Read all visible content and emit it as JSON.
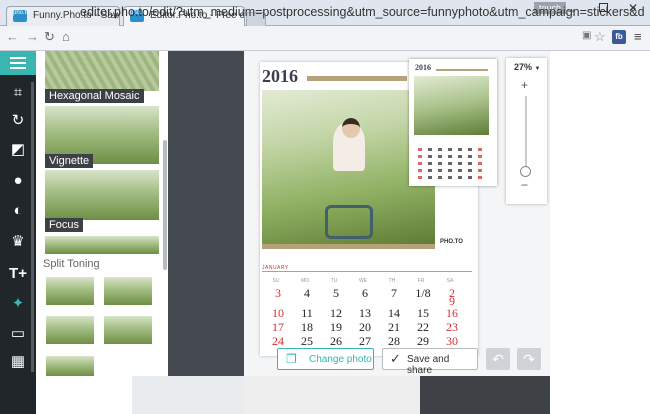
{
  "browser": {
    "tabs": [
      {
        "favicon": "pho.to",
        "title": "Funny.Pho.to - Save and"
      },
      {
        "favicon": "pho.to",
        "title": "Editor.Pho.to - Free onlin"
      }
    ],
    "user_badge": "touch",
    "url": "editor.pho.to/edit/?utm_medium=postprocessing&utm_source=funnyphoto&utm_campaign=stickers&d"
  },
  "panel": {
    "effects": [
      "Hexagonal Mosaic",
      "Vignette",
      "Focus"
    ],
    "section": "Split Toning"
  },
  "calendar": {
    "year": "2016",
    "logo": "PHO.TO",
    "month": "JANUARY",
    "weekdays": [
      "SU",
      "MO",
      "TU",
      "WE",
      "TH",
      "FR",
      "SA"
    ],
    "rows": [
      [
        "3",
        "4",
        "5",
        "6",
        "7",
        "1/8",
        "2"
      ],
      [
        "",
        "",
        "",
        "",
        "",
        "",
        "9"
      ],
      [
        "10",
        "11",
        "12",
        "13",
        "14",
        "15",
        "16"
      ],
      [
        "17",
        "18",
        "19",
        "20",
        "21",
        "22",
        "23"
      ],
      [
        "24",
        "25",
        "26",
        "27",
        "28",
        "29",
        "30"
      ]
    ]
  },
  "mini": {
    "year": "2016"
  },
  "zoom": {
    "value": "27%",
    "plus": "+",
    "minus": "−"
  },
  "actions": {
    "change_photo": "Change photo",
    "save_share": "Save and share"
  }
}
